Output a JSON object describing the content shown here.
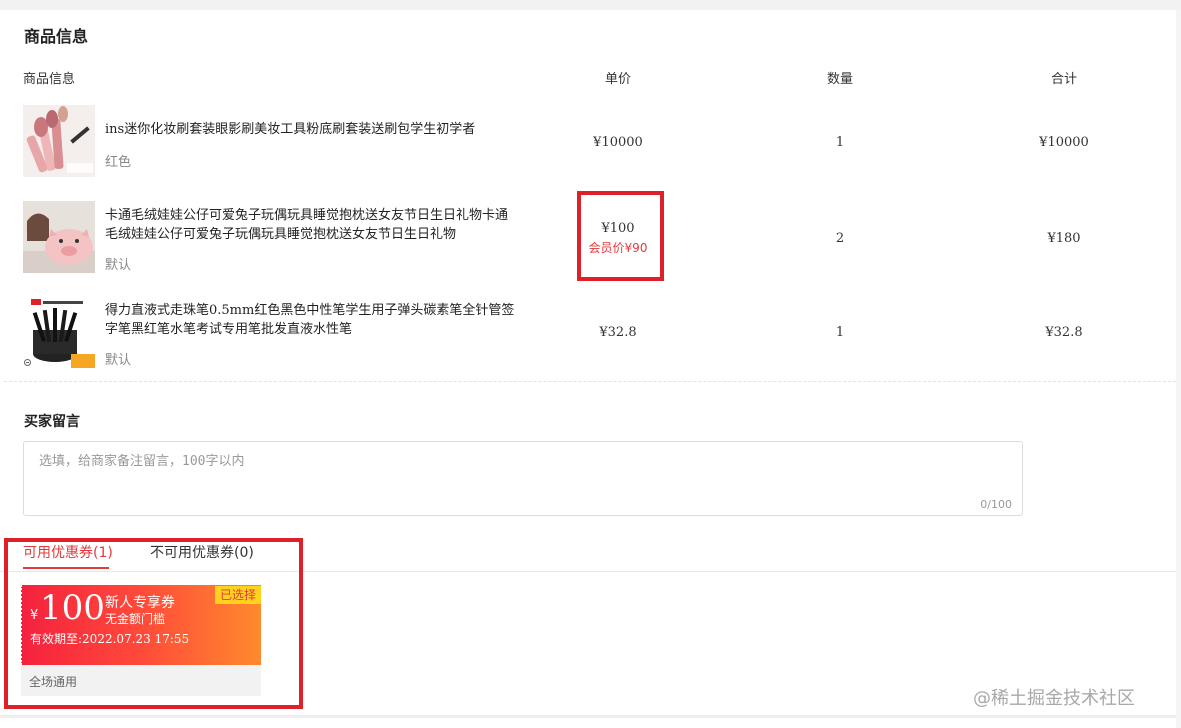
{
  "section_title": "商品信息",
  "columns": {
    "goods": "商品信息",
    "price": "单价",
    "qty": "数量",
    "total": "合计"
  },
  "items": [
    {
      "name": "ins迷你化妆刷套装眼影刷美妆工具粉底刷套装送刷包学生初学者",
      "spec": "红色",
      "price": "¥10000",
      "member_price": "",
      "qty": "1",
      "total": "¥10000",
      "image": "makeup-brush-set-image"
    },
    {
      "name": "卡通毛绒娃娃公仔可爱兔子玩偶玩具睡觉抱枕送女友节日生日礼物卡通毛绒娃娃公仔可爱兔子玩偶玩具睡觉抱枕送女友节日生日礼物",
      "spec": "默认",
      "price": "¥100",
      "member_price": "会员价¥90",
      "qty": "2",
      "total": "¥180",
      "image": "plush-pig-doll-image"
    },
    {
      "name": "得力直液式走珠笔0.5mm红色黑色中性笔学生用子弹头碳素笔全针管签字笔黑红笔水笔考试专用笔批发直液水性笔",
      "spec": "默认",
      "price": "¥32.8",
      "member_price": "",
      "qty": "1",
      "total": "¥32.8",
      "image": "gel-pens-image"
    }
  ],
  "message": {
    "title": "买家留言",
    "placeholder": "选填，给商家备注留言，100字以内",
    "counter": "0/100"
  },
  "coupon_tabs": {
    "available": "可用优惠券(1)",
    "unavailable": "不可用优惠券(0)"
  },
  "coupon": {
    "currency": "¥",
    "amount": "100",
    "name": "新人专享券",
    "condition": "无金额门槛",
    "valid": "有效期至:2022.07.23 17:55",
    "badge": "已选择",
    "scope": "全场通用"
  },
  "watermark": "@稀土掘金技术社区",
  "colors": {
    "accent": "#e4393c",
    "highlight_box": "#e02028",
    "coupon_gradient_start": "#f5213e",
    "coupon_gradient_end": "#ff8a2c",
    "badge_bg": "#ffd21e"
  }
}
